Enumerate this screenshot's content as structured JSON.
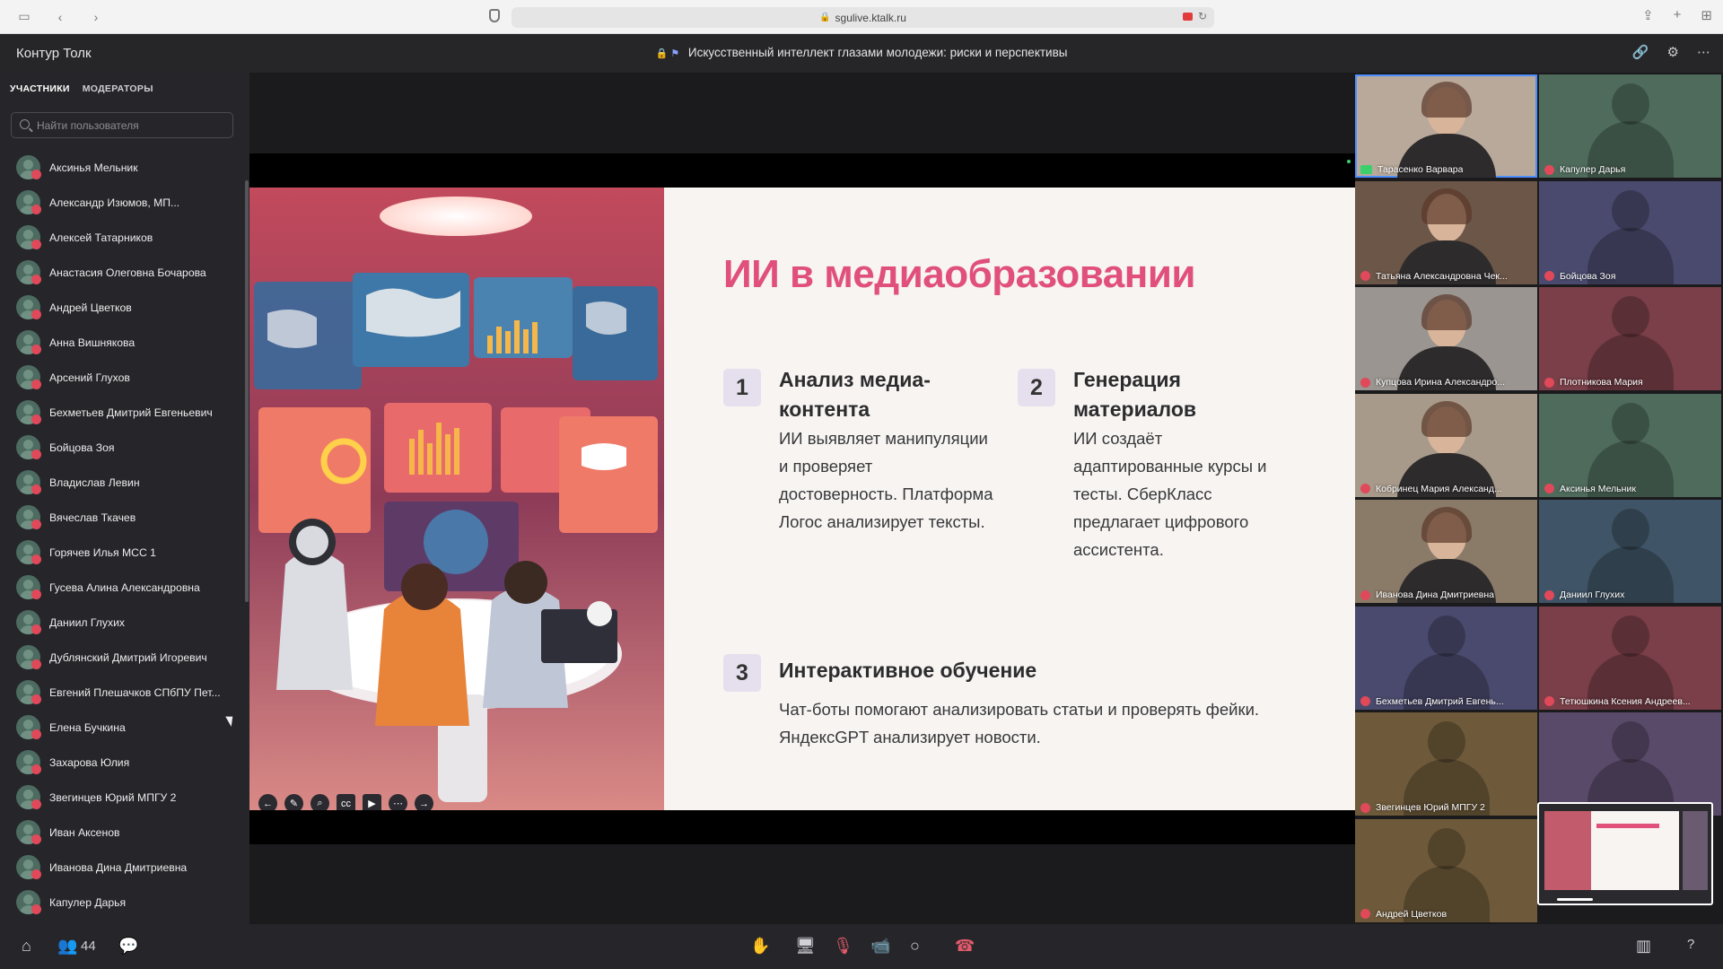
{
  "browser": {
    "url": "sgulive.ktalk.ru"
  },
  "app": {
    "brand": "Контур Толк",
    "meeting_title": "Искусственный интеллект глазами молодежи: риски и перспективы"
  },
  "sidebar": {
    "tabs": [
      {
        "label": "УЧАСТНИКИ"
      },
      {
        "label": "МОДЕРАТОРЫ"
      }
    ],
    "search_placeholder": "Найти пользователя",
    "participants": [
      "Аксинья Мельник",
      "Александр Изюмов, МП...",
      "Алексей Татарников",
      "Анастасия Олеговна Бочарова",
      "Андрей Цветков",
      "Анна Вишнякова",
      "Арсений Глухов",
      "Бехметьев Дмитрий Евгеньевич",
      "Бойцова Зоя",
      "Владислав Левин",
      "Вячеслав Ткачев",
      "Горячев Илья МСС 1",
      "Гусева Алина Александровна",
      "Даниил Глухих",
      "Дублянский Дмитрий Игоревич",
      "Евгений Плешачков СПбПУ Пет...",
      "Елена Бучкина",
      "Захарова Юлия",
      "Звегинцев Юрий МПГУ 2",
      "Иван Аксенов",
      "Иванова Дина Дмитриевна",
      "Капулер Дарья"
    ]
  },
  "slide": {
    "title": "ИИ в медиаобразовании",
    "sections": [
      {
        "num": "1",
        "title": "Анализ медиа-\nконтента",
        "text": "ИИ выявляет манипуляции\nи проверяет\nдостоверность. Платформа\nЛогос анализирует тексты."
      },
      {
        "num": "2",
        "title": "Генерация\nматериалов",
        "text": "ИИ создаёт\nадаптированные курсы и\nтесты. СберКласс\nпредлагает цифрового\nассистента."
      },
      {
        "num": "3",
        "title": "Интерактивное обучение",
        "text": "Чат-боты помогают анализировать статьи и проверять фейки.\nЯндексGPT анализирует новости."
      }
    ]
  },
  "video_tiles": [
    {
      "name": "Тарасенко Варвара",
      "bg": "#b8a99a",
      "camera": true,
      "active": true
    },
    {
      "name": "Капулер Дарья",
      "bg": "#4f6b5c",
      "camera": false
    },
    {
      "name": "Татьяна Александровна Чек...",
      "bg": "#6b5648",
      "camera": true
    },
    {
      "name": "Бойцова Зоя",
      "bg": "#4a4a6e",
      "camera": false
    },
    {
      "name": "Купцова Ирина Александро...",
      "bg": "#9a9590",
      "camera": true
    },
    {
      "name": "Плотникова Мария",
      "bg": "#7a3f48",
      "camera": false
    },
    {
      "name": "Кобринец Мария Александ...",
      "bg": "#a89a8a",
      "camera": true
    },
    {
      "name": "Аксинья Мельник",
      "bg": "#4f6b5c",
      "camera": false
    },
    {
      "name": "Иванова Дина Дмитриевна",
      "bg": "#8a7a68",
      "camera": true
    },
    {
      "name": "Даниил Глухих",
      "bg": "#3f5466",
      "camera": false
    },
    {
      "name": "Бехметьев Дмитрий Евгень...",
      "bg": "#4a4a6e",
      "camera": false
    },
    {
      "name": "Тетюшкина Ксения Андреев...",
      "bg": "#7a3f48",
      "camera": false
    },
    {
      "name": "Звегинцев Юрий МПГУ 2",
      "bg": "#6e5a3a",
      "camera": false
    },
    {
      "name": "",
      "bg": "#5a4a6a",
      "camera": false
    },
    {
      "name": "Андрей Цветков",
      "bg": "#6e5a3a",
      "camera": false
    }
  ],
  "bottombar": {
    "participant_count": "44"
  }
}
